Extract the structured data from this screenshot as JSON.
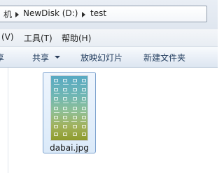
{
  "address_bar": {
    "segments": [
      "机",
      "NewDisk (D:)",
      "test"
    ]
  },
  "menu_bar": {
    "items": [
      "(V)",
      "工具(T)",
      "帮助(H)"
    ]
  },
  "command_bar": {
    "items": [
      "享",
      "共享",
      "放映幻灯片",
      "新建文件夹"
    ]
  },
  "files": [
    {
      "name": "dabai.jpg"
    }
  ]
}
